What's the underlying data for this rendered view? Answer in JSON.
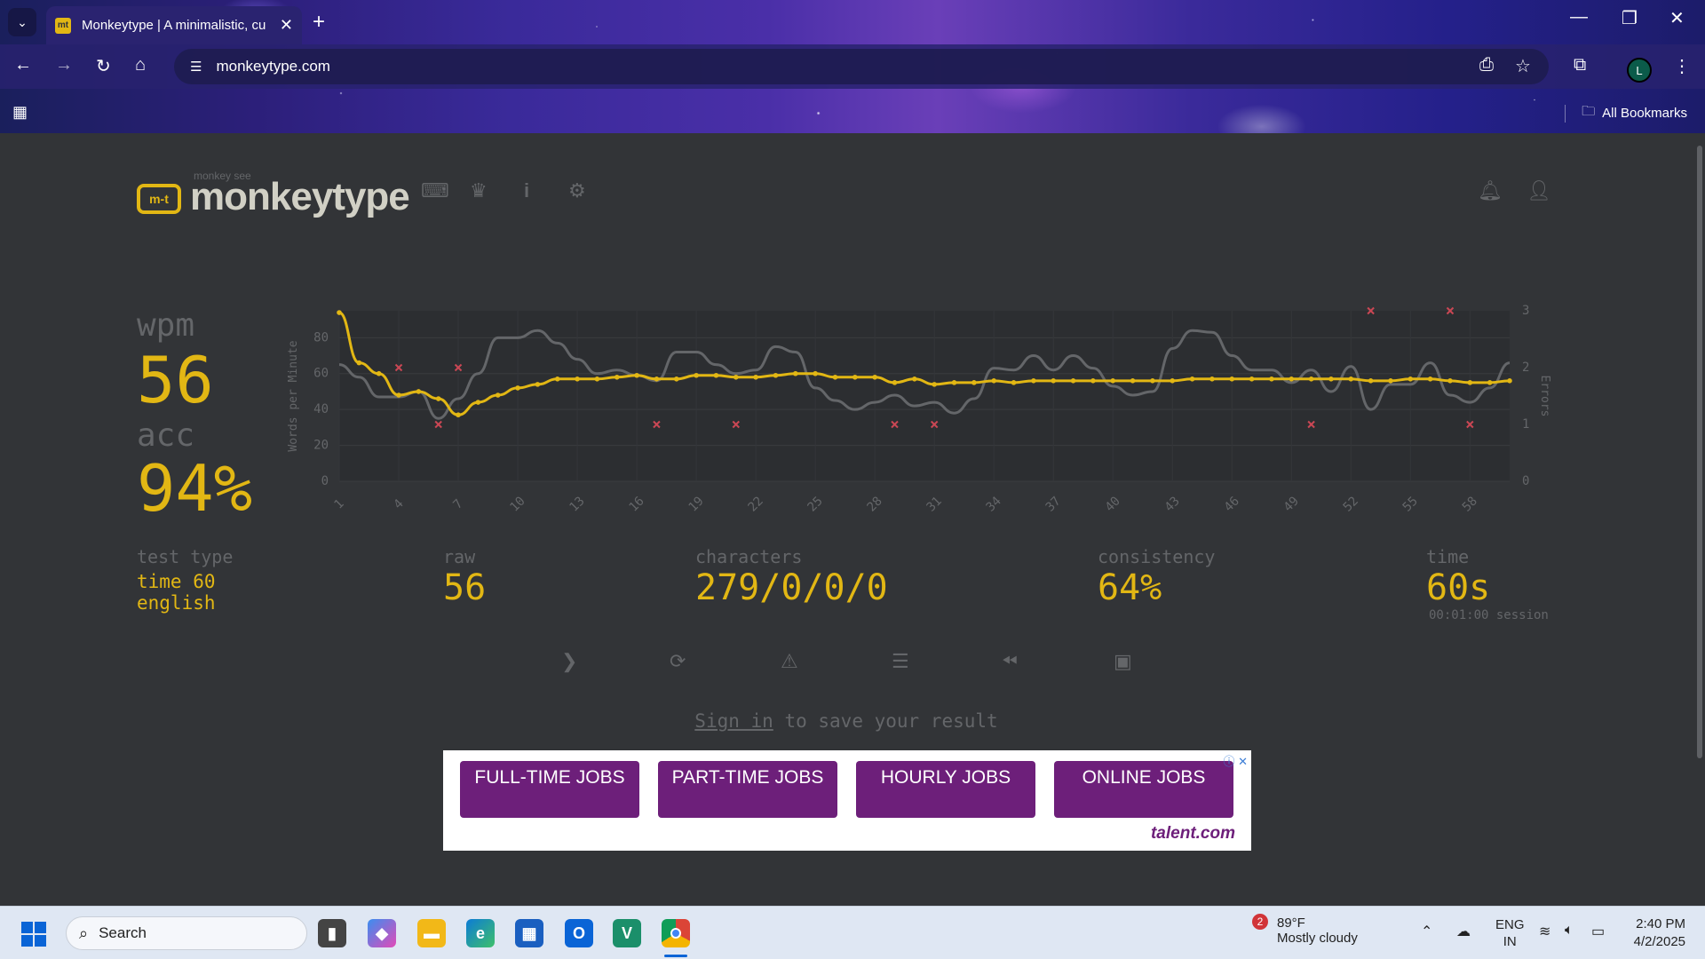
{
  "browser": {
    "tab_title": "Monkeytype | A minimalistic, cu",
    "tab_favicon": "mt",
    "url": "monkeytype.com",
    "all_bookmarks": "All Bookmarks",
    "profile_initial": "L"
  },
  "header": {
    "logo_small": "monkey see",
    "logo_text": "monkeytype",
    "logo_icon_text": "m-t"
  },
  "result": {
    "wpm_label": "wpm",
    "wpm_value": "56",
    "acc_label": "acc",
    "acc_value": "94%",
    "test_type_label": "test type",
    "test_type_line1": "time 60",
    "test_type_line2": "english",
    "raw_label": "raw",
    "raw_value": "56",
    "characters_label": "characters",
    "characters_value": "279/0/0/0",
    "consistency_label": "consistency",
    "consistency_value": "64%",
    "time_label": "time",
    "time_value": "60s",
    "session_time": "00:01:00 session"
  },
  "signin": {
    "link": "Sign in",
    "rest": " to save your result"
  },
  "ad": {
    "buttons": [
      "FULL-TIME JOBS",
      "PART-TIME JOBS",
      "HOURLY JOBS",
      "ONLINE JOBS"
    ],
    "brand": "talent.com"
  },
  "taskbar": {
    "search_placeholder": "Search",
    "weather_temp": "89°F",
    "weather_desc": "Mostly cloudy",
    "weather_badge": "2",
    "lang1": "ENG",
    "lang2": "IN",
    "time": "2:40 PM",
    "date": "4/2/2025"
  },
  "colors": {
    "accent": "#e2b714",
    "raw_line": "#646669",
    "error": "#ca4754",
    "bg": "#323437"
  },
  "chart_data": {
    "type": "line",
    "ylabel": "Words per Minute",
    "y2label": "Errors",
    "ylim": [
      0,
      95
    ],
    "y2lim": [
      0,
      3
    ],
    "yticks": [
      0,
      20,
      40,
      60,
      80
    ],
    "y2ticks": [
      0,
      1,
      2,
      3
    ],
    "xticks": [
      1,
      4,
      7,
      10,
      13,
      16,
      19,
      22,
      25,
      28,
      31,
      34,
      37,
      40,
      43,
      46,
      49,
      52,
      55,
      58
    ],
    "x": [
      1,
      2,
      3,
      4,
      5,
      6,
      7,
      8,
      9,
      10,
      11,
      12,
      13,
      14,
      15,
      16,
      17,
      18,
      19,
      20,
      21,
      22,
      23,
      24,
      25,
      26,
      27,
      28,
      29,
      30,
      31,
      32,
      33,
      34,
      35,
      36,
      37,
      38,
      39,
      40,
      41,
      42,
      43,
      44,
      45,
      46,
      47,
      48,
      49,
      50,
      51,
      52,
      53,
      54,
      55,
      56,
      57,
      58,
      59,
      60
    ],
    "series": [
      {
        "name": "wpm",
        "values": [
          94,
          66,
          60,
          48,
          50,
          46,
          37,
          44,
          48,
          52,
          54,
          57,
          57,
          57,
          58,
          59,
          57,
          57,
          59,
          59,
          58,
          58,
          59,
          60,
          60,
          58,
          58,
          58,
          55,
          57,
          54,
          55,
          55,
          56,
          55,
          56,
          56,
          56,
          56,
          56,
          56,
          56,
          56,
          57,
          57,
          57,
          57,
          57,
          57,
          57,
          57,
          57,
          56,
          56,
          57,
          57,
          56,
          55,
          55,
          56
        ]
      },
      {
        "name": "raw",
        "values": [
          65,
          58,
          47,
          47,
          50,
          35,
          46,
          60,
          80,
          80,
          84,
          77,
          68,
          60,
          62,
          59,
          56,
          72,
          72,
          65,
          60,
          62,
          75,
          72,
          52,
          45,
          40,
          44,
          48,
          42,
          44,
          38,
          46,
          63,
          62,
          70,
          62,
          70,
          63,
          53,
          48,
          50,
          74,
          84,
          83,
          70,
          62,
          62,
          55,
          62,
          50,
          64,
          40,
          54,
          54,
          66,
          48,
          44,
          52,
          66
        ]
      }
    ],
    "errors": [
      {
        "x": 4,
        "count": 2
      },
      {
        "x": 6,
        "count": 1
      },
      {
        "x": 7,
        "count": 2
      },
      {
        "x": 17,
        "count": 1
      },
      {
        "x": 21,
        "count": 1
      },
      {
        "x": 29,
        "count": 1
      },
      {
        "x": 31,
        "count": 1
      },
      {
        "x": 50,
        "count": 1
      },
      {
        "x": 53,
        "count": 3
      },
      {
        "x": 57,
        "count": 3
      },
      {
        "x": 58,
        "count": 1
      }
    ]
  }
}
